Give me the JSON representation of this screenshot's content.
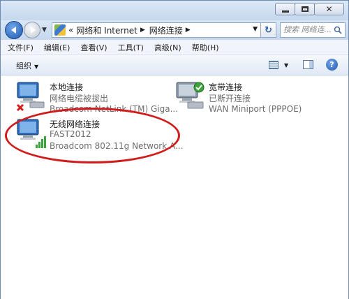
{
  "window": {
    "caption_buttons": [
      "minimize-icon",
      "maximize-icon",
      "close-icon"
    ]
  },
  "address_bar": {
    "prefix": "«",
    "segments": [
      "网络和 Internet",
      "网络连接"
    ],
    "separator": "▶",
    "dropdown_glyph": "▼",
    "refresh_glyph": "↻"
  },
  "search": {
    "placeholder": "搜索 网络连..."
  },
  "menu": {
    "items": [
      "文件(F)",
      "编辑(E)",
      "查看(V)",
      "工具(T)",
      "高级(N)",
      "帮助(H)"
    ]
  },
  "command_bar": {
    "organize_label": "组织",
    "organize_arrow": "▼",
    "view_arrow": "▼",
    "help_label": "?"
  },
  "connections": [
    {
      "name": "本地连接",
      "status": "网络电缆被拔出",
      "device": "Broadcom NetLink (TM) Giga...",
      "overlay": "red-x-icon"
    },
    {
      "name": "宽带连接",
      "status": "已断开连接",
      "device": "WAN Miniport (PPPOE)",
      "overlay": "green-check-icon"
    },
    {
      "name": "无线网络连接",
      "status": "FAST2012",
      "device": "Broadcom 802.11g Network A...",
      "overlay": "signal-bars-icon"
    }
  ],
  "colors": {
    "annotation_ring": "#d21c1c",
    "accent_blue": "#1f58b3"
  }
}
